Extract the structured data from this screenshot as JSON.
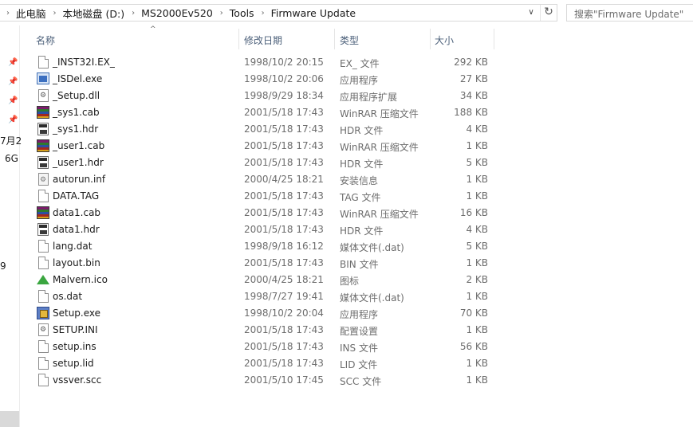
{
  "address": {
    "breadcrumbs": [
      "此电脑",
      "本地磁盘 (D:)",
      "MS2000Ev520",
      "Tools",
      "Firmware Update"
    ]
  },
  "search": {
    "placeholder": "搜索\"Firmware Update\""
  },
  "nav_fragments": [
    "7月2",
    "6G",
    "9"
  ],
  "columns": {
    "name": "名称",
    "date": "修改日期",
    "type": "类型",
    "size": "大小"
  },
  "files": [
    {
      "name": "_INST32I.EX_",
      "date": "1998/10/2 20:15",
      "type": "EX_ 文件",
      "size": "292 KB",
      "icon": "generic-file-icon"
    },
    {
      "name": "_ISDel.exe",
      "date": "1998/10/2 20:06",
      "type": "应用程序",
      "size": "27 KB",
      "icon": "application-icon"
    },
    {
      "name": "_Setup.dll",
      "date": "1998/9/29 18:34",
      "type": "应用程序扩展",
      "size": "34 KB",
      "icon": "dll-icon"
    },
    {
      "name": "_sys1.cab",
      "date": "2001/5/18 17:43",
      "type": "WinRAR 压缩文件",
      "size": "188 KB",
      "icon": "winrar-archive-icon"
    },
    {
      "name": "_sys1.hdr",
      "date": "2001/5/18 17:43",
      "type": "HDR 文件",
      "size": "4 KB",
      "icon": "hdr-file-icon"
    },
    {
      "name": "_user1.cab",
      "date": "2001/5/18 17:43",
      "type": "WinRAR 压缩文件",
      "size": "1 KB",
      "icon": "winrar-archive-icon"
    },
    {
      "name": "_user1.hdr",
      "date": "2001/5/18 17:43",
      "type": "HDR 文件",
      "size": "5 KB",
      "icon": "hdr-file-icon"
    },
    {
      "name": "autorun.inf",
      "date": "2000/4/25 18:21",
      "type": "安装信息",
      "size": "1 KB",
      "icon": "setup-info-icon"
    },
    {
      "name": "DATA.TAG",
      "date": "2001/5/18 17:43",
      "type": "TAG 文件",
      "size": "1 KB",
      "icon": "generic-file-icon"
    },
    {
      "name": "data1.cab",
      "date": "2001/5/18 17:43",
      "type": "WinRAR 压缩文件",
      "size": "16 KB",
      "icon": "winrar-archive-icon"
    },
    {
      "name": "data1.hdr",
      "date": "2001/5/18 17:43",
      "type": "HDR 文件",
      "size": "4 KB",
      "icon": "hdr-file-icon"
    },
    {
      "name": "lang.dat",
      "date": "1998/9/18 16:12",
      "type": "媒体文件(.dat)",
      "size": "5 KB",
      "icon": "generic-file-icon"
    },
    {
      "name": "layout.bin",
      "date": "2001/5/18 17:43",
      "type": "BIN 文件",
      "size": "1 KB",
      "icon": "generic-file-icon"
    },
    {
      "name": "Malvern.ico",
      "date": "2000/4/25 18:21",
      "type": "图标",
      "size": "2 KB",
      "icon": "malvern-logo-icon"
    },
    {
      "name": "os.dat",
      "date": "1998/7/27 19:41",
      "type": "媒体文件(.dat)",
      "size": "1 KB",
      "icon": "generic-file-icon"
    },
    {
      "name": "Setup.exe",
      "date": "1998/10/2 20:04",
      "type": "应用程序",
      "size": "70 KB",
      "icon": "setup-installer-icon"
    },
    {
      "name": "SETUP.INI",
      "date": "2001/5/18 17:43",
      "type": "配置设置",
      "size": "1 KB",
      "icon": "config-settings-icon"
    },
    {
      "name": "setup.ins",
      "date": "2001/5/18 17:43",
      "type": "INS 文件",
      "size": "56 KB",
      "icon": "generic-file-icon"
    },
    {
      "name": "setup.lid",
      "date": "2001/5/18 17:43",
      "type": "LID 文件",
      "size": "1 KB",
      "icon": "generic-file-icon"
    },
    {
      "name": "vssver.scc",
      "date": "2001/5/10 17:45",
      "type": "SCC 文件",
      "size": "1 KB",
      "icon": "generic-file-icon"
    }
  ]
}
